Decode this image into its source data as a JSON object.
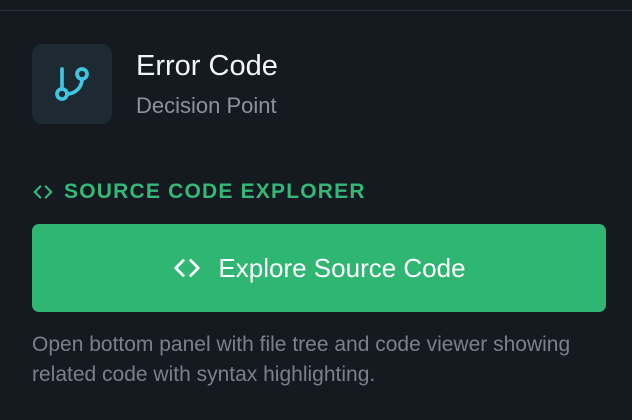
{
  "node": {
    "title": "Error Code",
    "subtitle": "Decision Point",
    "icon": "git-branch-icon"
  },
  "section": {
    "label": "SOURCE CODE EXPLORER",
    "icon": "code-brackets-icon"
  },
  "explore_button": {
    "label": "Explore Source Code",
    "icon": "code-brackets-icon"
  },
  "description": "Open bottom panel with file tree and code viewer showing related code with syntax highlighting.",
  "colors": {
    "background": "#151a20",
    "accent_green": "#2fb673",
    "icon_cyan": "#3fc6e3"
  }
}
